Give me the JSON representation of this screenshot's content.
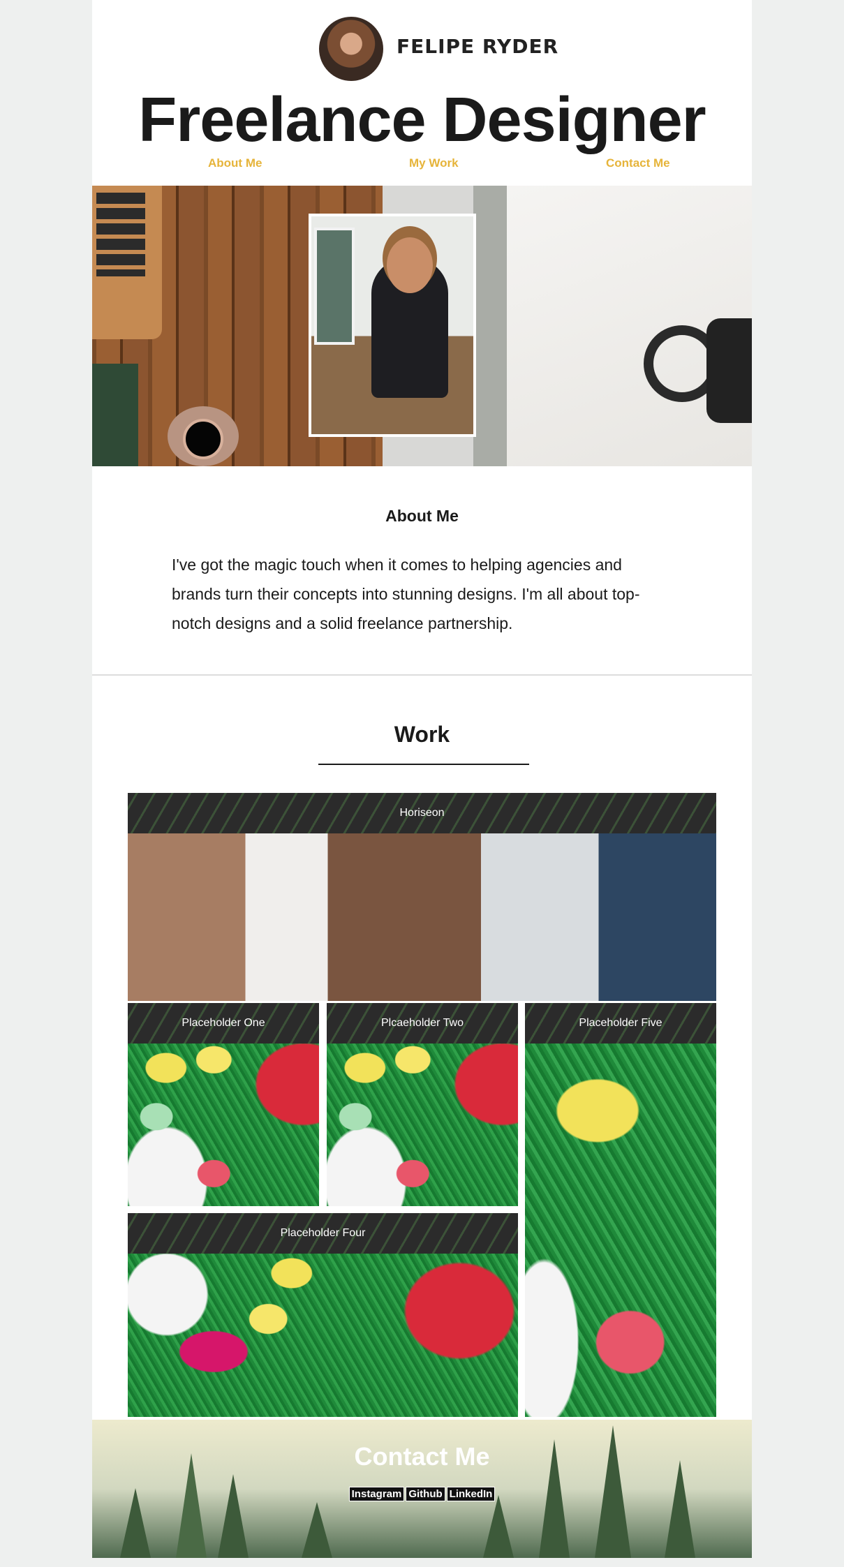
{
  "header": {
    "name": "FELIPE RYDER",
    "title": "Freelance Designer",
    "nav": [
      "About Me",
      "My Work",
      "Contact Me"
    ]
  },
  "about": {
    "heading": "About Me",
    "text": "I've got the magic touch when it comes to helping agencies and brands turn their concepts into stunning designs. I'm all about top-notch designs and a solid freelance partnership."
  },
  "work": {
    "heading": "Work",
    "projects": [
      "Horiseon",
      "Placeholder One",
      "Plcaeholder Two",
      "Placeholder Five",
      "Placeholder Four"
    ]
  },
  "contact": {
    "heading": "Contact Me",
    "links": [
      "Instagram",
      "Github",
      "LinkedIn"
    ]
  },
  "colors": {
    "accent": "#e6b43a",
    "text": "#1a1a1a",
    "background": "#eef0ef"
  }
}
